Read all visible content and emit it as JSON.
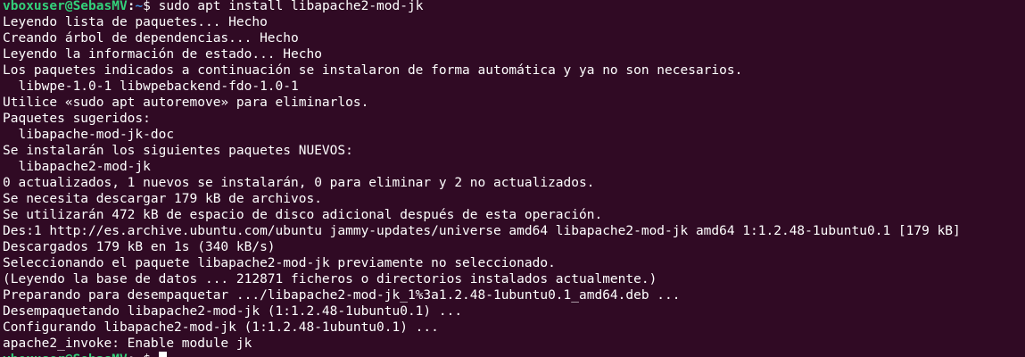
{
  "terminal": {
    "colors": {
      "background": "#300a24",
      "text": "#ffffff",
      "prompt_user": "#33d17a",
      "prompt_path": "#3f8cd8"
    },
    "prompt": {
      "user_host": "vboxuser@SebasMV",
      "separator": ":",
      "path": "~",
      "symbol": "$ "
    },
    "command": "sudo apt install libapache2-mod-jk",
    "output": [
      "Leyendo lista de paquetes... Hecho",
      "Creando árbol de dependencias... Hecho",
      "Leyendo la información de estado... Hecho",
      "Los paquetes indicados a continuación se instalaron de forma automática y ya no son necesarios.",
      "  libwpe-1.0-1 libwpebackend-fdo-1.0-1",
      "Utilice «sudo apt autoremove» para eliminarlos.",
      "Paquetes sugeridos:",
      "  libapache-mod-jk-doc",
      "Se instalarán los siguientes paquetes NUEVOS:",
      "  libapache2-mod-jk",
      "0 actualizados, 1 nuevos se instalarán, 0 para eliminar y 2 no actualizados.",
      "Se necesita descargar 179 kB de archivos.",
      "Se utilizarán 472 kB de espacio de disco adicional después de esta operación.",
      "Des:1 http://es.archive.ubuntu.com/ubuntu jammy-updates/universe amd64 libapache2-mod-jk amd64 1:1.2.48-1ubuntu0.1 [179 kB]",
      "Descargados 179 kB en 1s (340 kB/s)",
      "Seleccionando el paquete libapache2-mod-jk previamente no seleccionado.",
      "(Leyendo la base de datos ... 212871 ficheros o directorios instalados actualmente.)",
      "Preparando para desempaquetar .../libapache2-mod-jk_1%3a1.2.48-1ubuntu0.1_amd64.deb ...",
      "Desempaquetando libapache2-mod-jk (1:1.2.48-1ubuntu0.1) ...",
      "Configurando libapache2-mod-jk (1:1.2.48-1ubuntu0.1) ...",
      "apache2_invoke: Enable module jk"
    ]
  }
}
